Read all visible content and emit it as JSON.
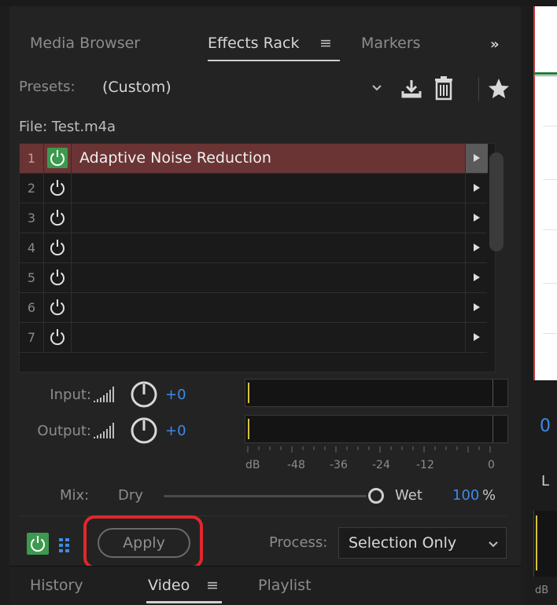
{
  "tabs": [
    {
      "label": "Media Browser",
      "active": false
    },
    {
      "label": "Effects Rack",
      "active": true
    },
    {
      "label": "Markers",
      "active": false
    }
  ],
  "tab_menu_glyph": "≡",
  "overflow_glyph": "»",
  "presets": {
    "label": "Presets:",
    "value": "(Custom)",
    "icons": [
      "chevron-down-icon",
      "save-preset-icon",
      "delete-preset-icon",
      "favorite-star-icon"
    ]
  },
  "file": {
    "label": "File: Test.m4a"
  },
  "effects": [
    {
      "slot": "1",
      "name": "Adaptive Noise Reduction",
      "enabled": true,
      "selected": true
    },
    {
      "slot": "2",
      "name": "",
      "enabled": false,
      "selected": false
    },
    {
      "slot": "3",
      "name": "",
      "enabled": false,
      "selected": false
    },
    {
      "slot": "4",
      "name": "",
      "enabled": false,
      "selected": false
    },
    {
      "slot": "5",
      "name": "",
      "enabled": false,
      "selected": false
    },
    {
      "slot": "6",
      "name": "",
      "enabled": false,
      "selected": false
    },
    {
      "slot": "7",
      "name": "",
      "enabled": false,
      "selected": false
    }
  ],
  "io": {
    "input_label": "Input:",
    "input_value": "+0",
    "output_label": "Output:",
    "output_value": "+0"
  },
  "meter_scale": [
    "dB",
    "-48",
    "-36",
    "-24",
    "-12",
    "0"
  ],
  "mix": {
    "label": "Mix:",
    "dry_label": "Dry",
    "wet_label": "Wet",
    "value": "100",
    "unit": "%",
    "fraction": 1.0
  },
  "apply": {
    "label": "Apply"
  },
  "process": {
    "label": "Process:",
    "value": "Selection Only"
  },
  "bottom_tabs": [
    {
      "label": "History",
      "active": false
    },
    {
      "label": "Video",
      "active": true
    },
    {
      "label": "Playlist",
      "active": false
    }
  ],
  "right_panel": {
    "char_blue": "0",
    "char_tab": "L",
    "char_db": "dB"
  },
  "colors": {
    "accent_blue": "#3f8ae6",
    "enabled_green": "#3c9a4e",
    "selected_row": "#6b3434",
    "meter_yellow": "#d8c23a",
    "highlight_red": "#e0282c"
  }
}
